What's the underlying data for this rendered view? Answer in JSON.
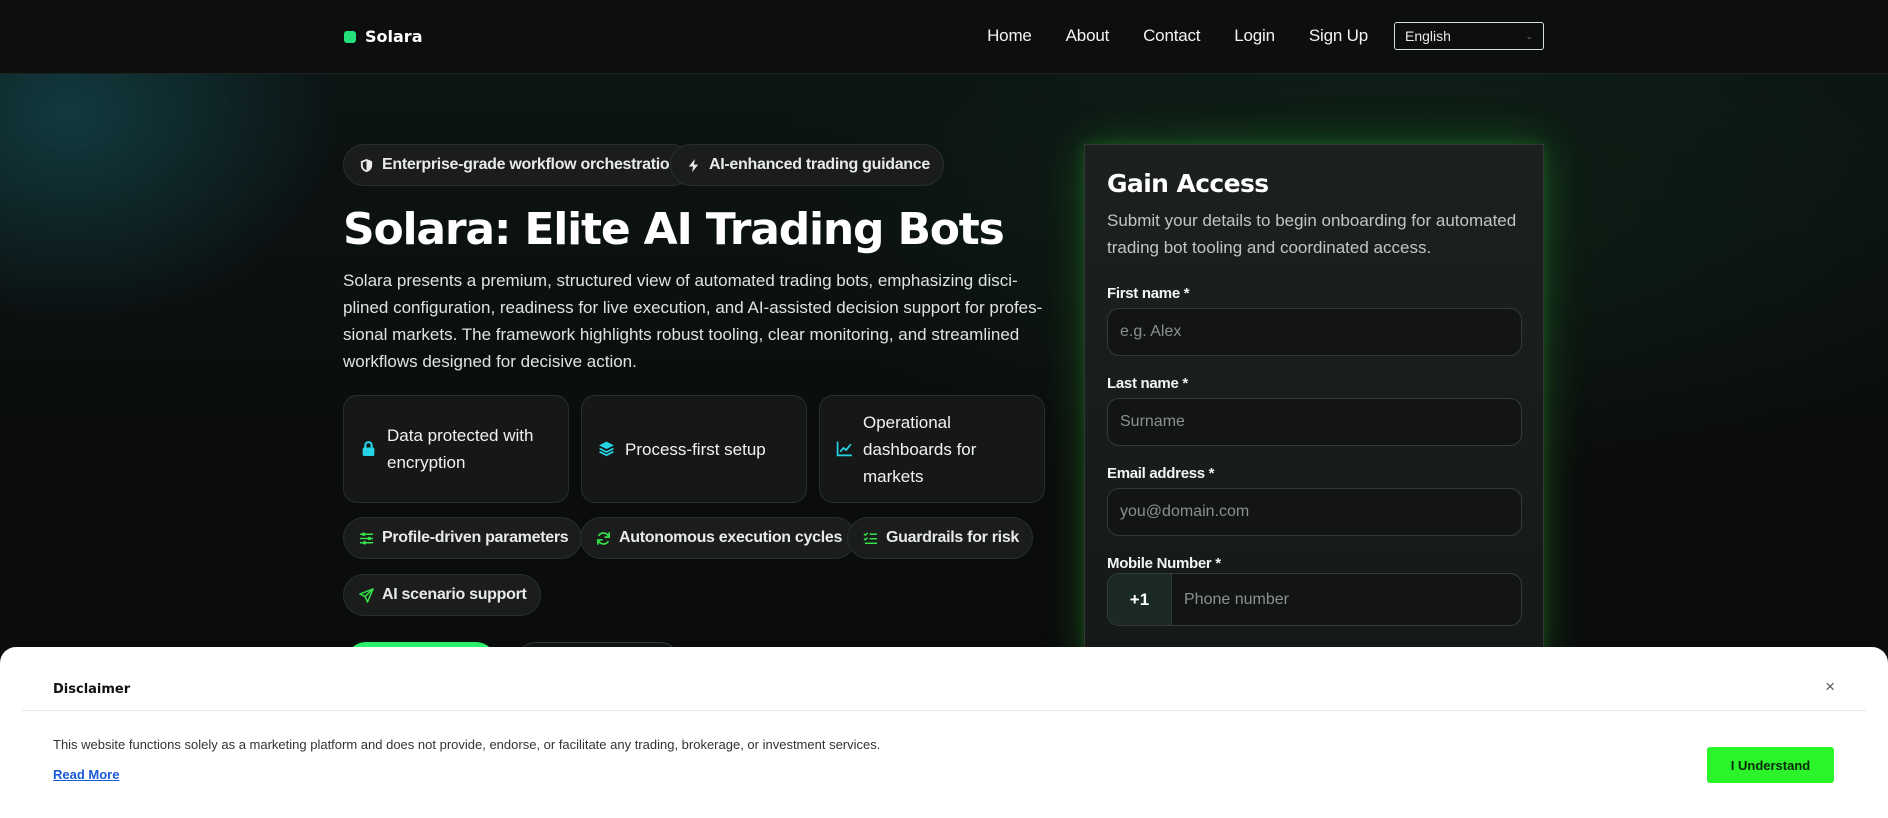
{
  "brand": {
    "name": "Solara",
    "accent": "#23e07a"
  },
  "nav": {
    "links": [
      "Home",
      "About",
      "Contact",
      "Login",
      "Sign Up"
    ],
    "language": "English"
  },
  "hero": {
    "pills_top": [
      {
        "icon": "shield-icon",
        "label": "Enterprise-grade workflow orchestration"
      },
      {
        "icon": "bolt-icon",
        "label": "AI-enhanced trading guidance"
      }
    ],
    "title": "Solara: Elite AI Trading Bots",
    "description": "Solara presents a premium, structured view of automated trading bots, emphasizing disci­plined configuration, readiness for live execution, and AI-assisted decision support for profes­sional markets. The framework highlights robust tooling, clear monitoring, and streamlined workflows designed for decisive action.",
    "features": [
      {
        "icon": "lock-icon",
        "label": "Data protected with encryption"
      },
      {
        "icon": "layers-icon",
        "label": "Process-first setup"
      },
      {
        "icon": "chart-line-icon",
        "label": "Operational dashboards for markets"
      }
    ],
    "pills_bottom": [
      {
        "icon": "sliders-icon",
        "label": "Profile-driven parameters"
      },
      {
        "icon": "refresh-icon",
        "label": "Autonomous execution cycles"
      },
      {
        "icon": "checklist-icon",
        "label": "Guardrails for risk"
      },
      {
        "icon": "send-icon",
        "label": "AI scenario support"
      }
    ]
  },
  "form": {
    "title": "Gain Access",
    "subtitle": "Submit your details to begin onboarding for automated trading bot tooling and coordinated access.",
    "first_name": {
      "label": "First name *",
      "placeholder": "e.g. Alex"
    },
    "last_name": {
      "label": "Last name *",
      "placeholder": "Surname"
    },
    "email": {
      "label": "Email address *",
      "placeholder": "you@domain.com"
    },
    "mobile": {
      "label": "Mobile Number *",
      "code": "+1",
      "placeholder": "Phone number"
    }
  },
  "disclaimer": {
    "title": "Disclaimer",
    "close": "×",
    "text": "This website functions solely as a marketing platform and does not provide, endorse, or facilitate any trading, brokerage, or investment services.",
    "link": "Read More",
    "button": "I Understand",
    "button_color": "#2cf42a"
  },
  "colors": {
    "icon_cyan": "#27d4e6",
    "icon_green": "#35e04a",
    "glow": "#3cdc3c"
  }
}
